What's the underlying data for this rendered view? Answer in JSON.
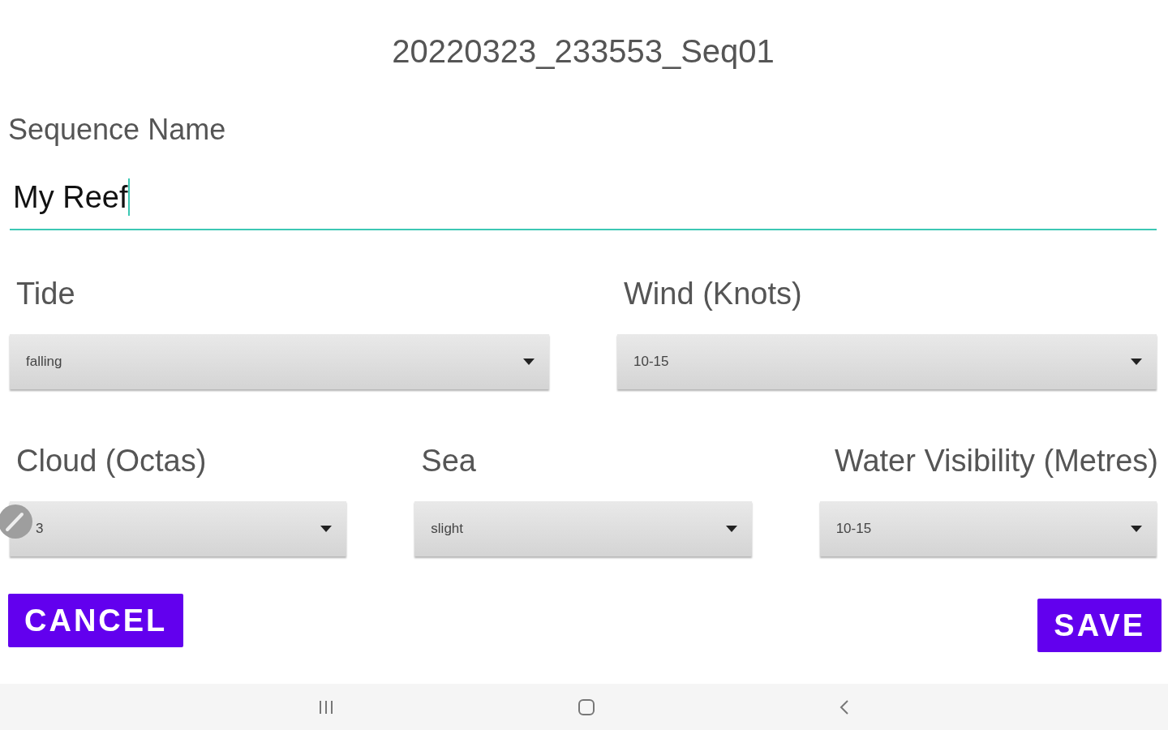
{
  "title": "20220323_233553_Seq01",
  "sequence_name": {
    "label": "Sequence Name",
    "value": "My Reef",
    "focused": true
  },
  "rows": [
    {
      "fields": [
        {
          "label": "Tide",
          "value": "falling"
        },
        {
          "label": "Wind (Knots)",
          "value": "10-15"
        }
      ]
    },
    {
      "fields": [
        {
          "label": "Cloud (Octas)",
          "value": "3"
        },
        {
          "label": "Sea",
          "value": "slight"
        },
        {
          "label": "Water Visibility (Metres)",
          "value": "10-15"
        }
      ]
    }
  ],
  "buttons": [
    {
      "label": "CANCEL",
      "kind": "cancel"
    },
    {
      "label": "SAVE",
      "kind": "save"
    }
  ]
}
